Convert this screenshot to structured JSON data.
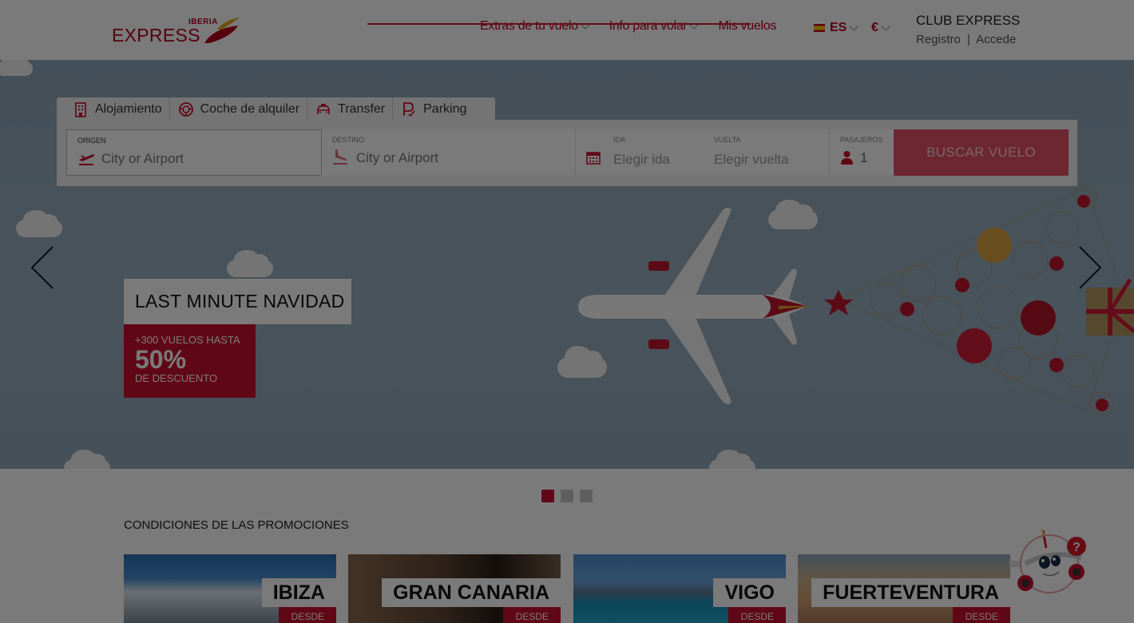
{
  "header": {
    "logo_top": "IBERIA",
    "logo_main": "EXPRESS",
    "nav": [
      {
        "label": "Extras de tu vuelo",
        "has_dropdown": true
      },
      {
        "label": "Info para volar",
        "has_dropdown": true
      },
      {
        "label": "Mis vuelos",
        "has_dropdown": false
      }
    ],
    "language": "ES",
    "currency": "€",
    "club_title": "CLUB EXPRESS",
    "club_register": "Registro",
    "club_separator": "|",
    "club_login": "Accede"
  },
  "search": {
    "tabs": [
      {
        "label": "Alojamiento",
        "icon": "hotel-icon"
      },
      {
        "label": "Coche de alquiler",
        "icon": "steering-wheel-icon"
      },
      {
        "label": "Transfer",
        "icon": "taxi-icon"
      },
      {
        "label": "Parking",
        "icon": "parking-icon"
      }
    ],
    "origin_label": "ORIGEN",
    "origin_placeholder": "City or Airport",
    "destination_label": "DESTINO",
    "destination_placeholder": "City or Airport",
    "departure_label": "IDA",
    "departure_placeholder": "Elegir ida",
    "return_label": "VUELTA",
    "return_placeholder": "Elegir vuelta",
    "passengers_label": "PASAJEROS",
    "passengers_value": "1",
    "search_button": "BUSCAR VUELO"
  },
  "hero": {
    "title": "LAST MINUTE NAVIDAD",
    "line1": "+300 VUELOS HASTA",
    "line2": "50%",
    "line3": "DE DESCUENTO",
    "slides_total": 3,
    "active_slide": 1
  },
  "conditions_link": "CONDICIONES DE LAS PROMOCIONES",
  "destinations": [
    {
      "name": "IBIZA",
      "tag": "DESDE"
    },
    {
      "name": "GRAN CANARIA",
      "tag": "DESDE"
    },
    {
      "name": "VIGO",
      "tag": "DESDE"
    },
    {
      "name": "FUERTEVENTURA",
      "tag": "DESDE"
    }
  ],
  "help_bot": {
    "badge": "?"
  },
  "colors": {
    "brand_red": "#c8102e",
    "nav_red": "#b5001f",
    "overlay": "rgba(0,0,0,0.52)"
  }
}
